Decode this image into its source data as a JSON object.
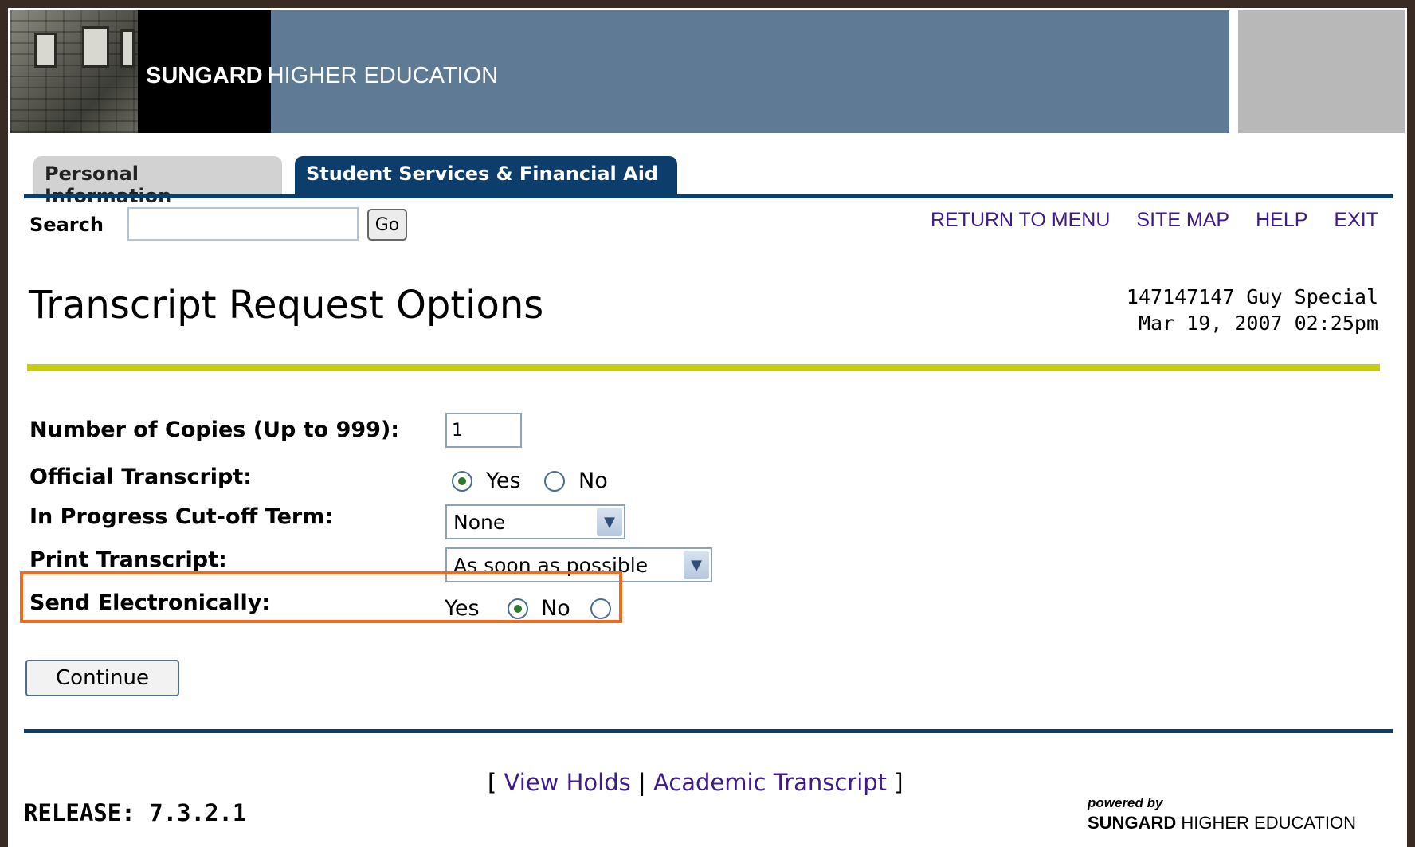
{
  "header": {
    "logo_brand": "SUNGARD",
    "logo_sub": "HIGHER EDUCATION"
  },
  "tabs": [
    {
      "label": "Personal Information",
      "active": false
    },
    {
      "label": "Student Services & Financial Aid",
      "active": true
    }
  ],
  "search": {
    "label": "Search",
    "value": "",
    "go_label": "Go"
  },
  "toplinks": {
    "return_to_menu": "RETURN TO MENU",
    "site_map": "SITE MAP",
    "help": "HELP",
    "exit": "EXIT"
  },
  "page": {
    "title": "Transcript Request Options",
    "user_line": "147147147 Guy Special",
    "datetime_line": "Mar 19, 2007 02:25pm"
  },
  "form": {
    "copies": {
      "label": "Number of Copies (Up to 999):",
      "value": "1"
    },
    "official": {
      "label": "Official Transcript:",
      "yes_label": "Yes",
      "no_label": "No",
      "selected": "Yes"
    },
    "cutoff": {
      "label": "In Progress Cut-off Term:",
      "selected": "None"
    },
    "print": {
      "label": "Print Transcript:",
      "selected": "As soon as possible"
    },
    "electronic": {
      "label": "Send Electronically:",
      "yes_label": "Yes",
      "no_label": "No",
      "selected": "Yes"
    },
    "continue_label": "Continue"
  },
  "footer": {
    "bracket_open": "[",
    "view_holds": "View Holds",
    "separator": "|",
    "academic_transcript": "Academic Transcript",
    "bracket_close": "]",
    "release": "RELEASE: 7.3.2.1",
    "powered_by": "powered by",
    "powered_brand": "SUNGARD",
    "powered_sub": "HIGHER EDUCATION"
  },
  "colors": {
    "header_blue": "#5e7a94",
    "tab_active": "#0d3d6b",
    "rule_yellow": "#c8cc0f",
    "link_purple": "#3f1a8c",
    "highlight_orange": "#f26a1b"
  }
}
